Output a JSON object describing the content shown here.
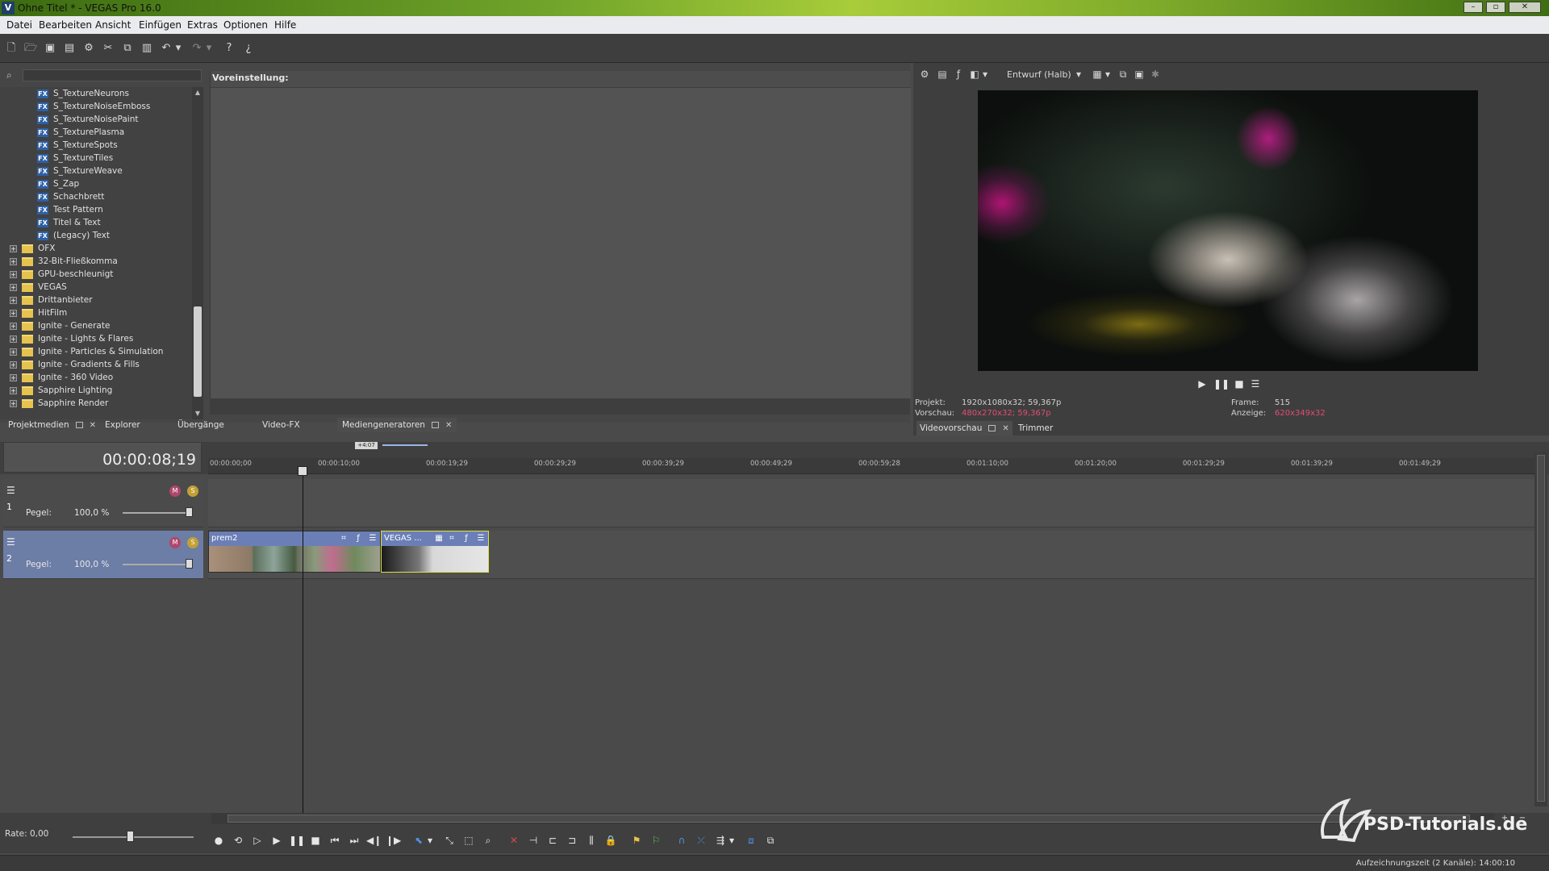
{
  "window": {
    "title": "Ohne Titel * - VEGAS Pro 16.0",
    "app_icon": "V"
  },
  "menu": [
    "Datei",
    "Bearbeiten",
    "Ansicht",
    "Einfügen",
    "Extras",
    "Optionen",
    "Hilfe"
  ],
  "browser": {
    "search_placeholder": "",
    "preset_label": "Voreinstellung:",
    "fx_badge": "FX",
    "tree_fx_items": [
      "S_TextureNeurons",
      "S_TextureNoiseEmboss",
      "S_TextureNoisePaint",
      "S_TexturePlasma",
      "S_TextureSpots",
      "S_TextureTiles",
      "S_TextureWeave",
      "S_Zap",
      "Schachbrett",
      "Test Pattern",
      "Titel & Text",
      "(Legacy) Text"
    ],
    "tree_folders": [
      "OFX",
      "32-Bit-Fließkomma",
      "GPU-beschleunigt",
      "VEGAS",
      "Drittanbieter",
      "HitFilm",
      "Ignite - Generate",
      "Ignite - Lights & Flares",
      "Ignite - Particles & Simulation",
      "Ignite - Gradients & Fills",
      "Ignite - 360 Video",
      "Sapphire Lighting",
      "Sapphire Render"
    ],
    "tabs": [
      "Projektmedien",
      "Explorer",
      "Übergänge",
      "Video-FX",
      "Mediengeneratoren"
    ]
  },
  "preview": {
    "quality": "Entwurf (Halb)",
    "projekt_label": "Projekt:",
    "projekt_value": "1920x1080x32; 59,367p",
    "vorschau_label": "Vorschau:",
    "vorschau_value": "480x270x32; 59,367p",
    "frame_label": "Frame:",
    "frame_value": "515",
    "anzeige_label": "Anzeige:",
    "anzeige_value": "620x349x32",
    "tabs": [
      "Videovorschau",
      "Trimmer"
    ]
  },
  "timeline": {
    "timecode": "00:00:08;19",
    "zoom_badge": "+4:07",
    "ruler_labels": [
      "00:00:00;00",
      "00:00:10;00",
      "00:00:19;29",
      "00:00:29;29",
      "00:00:39;29",
      "00:00:49;29",
      "00:00:59;28",
      "00:01:10;00",
      "00:01:20;00",
      "00:01:29;29",
      "00:01:39;29",
      "00:01:49;29"
    ],
    "tracks": [
      {
        "number": "1",
        "level_label": "Pegel:",
        "level_value": "100,0 %"
      },
      {
        "number": "2",
        "level_label": "Pegel:",
        "level_value": "100,0 %"
      }
    ],
    "clips": [
      {
        "name": "prem2"
      },
      {
        "name": "VEGAS ..."
      }
    ]
  },
  "transport": {
    "rate": "Rate: 0,00"
  },
  "status": {
    "text": "Aufzeichnungszeit (2 Kanäle): 14:00:10"
  },
  "watermark": {
    "text": "PSD-Tutorials.de"
  },
  "colors": {
    "accent_green": "#8cbd2f",
    "clip_header": "#6b7fb6",
    "pink_value": "#e24d74",
    "selection_yellow": "#e0e040"
  }
}
